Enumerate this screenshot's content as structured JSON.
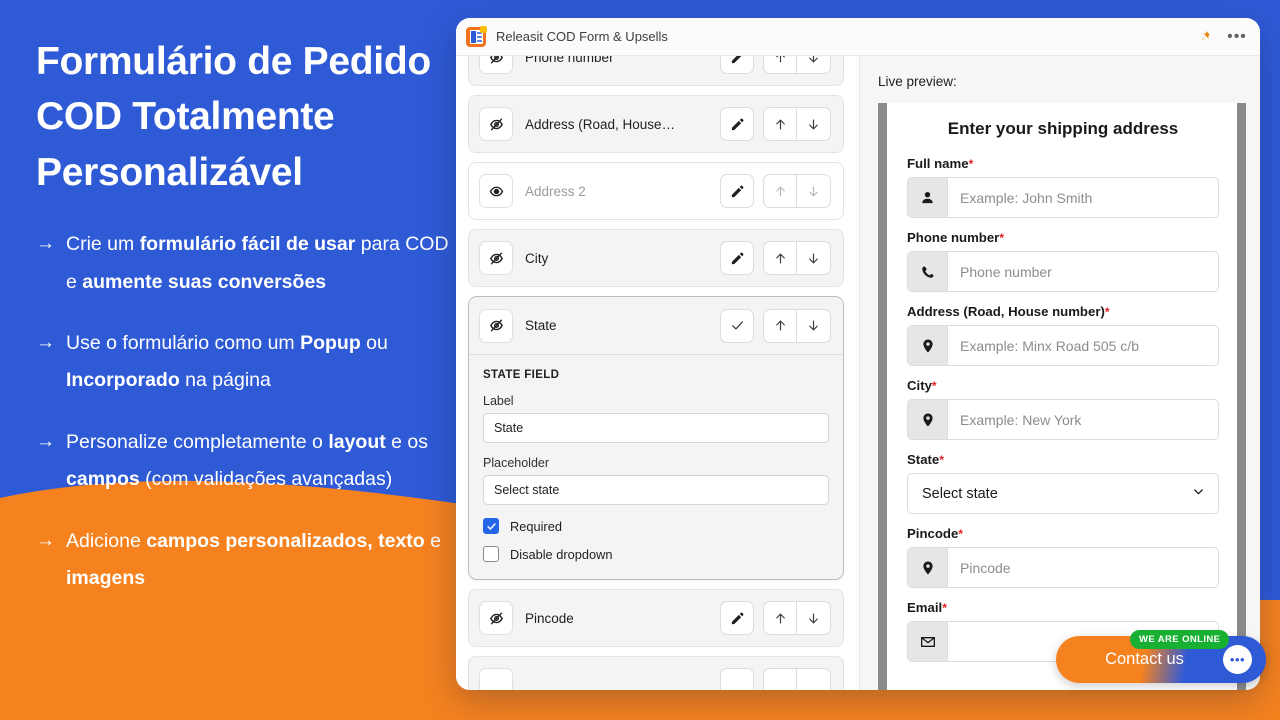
{
  "promo": {
    "title": "Formulário de Pedido COD Totalmente Personalizável",
    "arrow": "→",
    "bullets": [
      {
        "parts": [
          {
            "t": "Crie um ",
            "b": false
          },
          {
            "t": "formulário fácil de usar",
            "b": true
          },
          {
            "t": " para COD e ",
            "b": false
          },
          {
            "t": "aumente suas conversões",
            "b": true
          }
        ]
      },
      {
        "parts": [
          {
            "t": "Use o formulário como um ",
            "b": false
          },
          {
            "t": "Popup",
            "b": true
          },
          {
            "t": " ou ",
            "b": false
          },
          {
            "t": "Incorporado",
            "b": true
          },
          {
            "t": " na página",
            "b": false
          }
        ]
      },
      {
        "parts": [
          {
            "t": "Personalize completamente o ",
            "b": false
          },
          {
            "t": "layout",
            "b": true
          },
          {
            "t": " e os ",
            "b": false
          },
          {
            "t": "campos",
            "b": true
          },
          {
            "t": " (com validações avançadas)",
            "b": false
          }
        ]
      },
      {
        "parts": [
          {
            "t": "Adicione ",
            "b": false
          },
          {
            "t": "campos personalizados, texto",
            "b": true
          },
          {
            "t": " e ",
            "b": false
          },
          {
            "t": "imagens",
            "b": true
          }
        ]
      }
    ],
    "colors": {
      "blue": "#2f5ad6",
      "orange": "#f5821f",
      "white": "#ffffff"
    }
  },
  "window": {
    "title": "Releasit COD Form & Upsells",
    "app_icon": "releasit-app-icon",
    "pin_icon": "pushpin-icon",
    "more_icon": "more-options-icon",
    "more_label": "•••"
  },
  "field_list": {
    "rows": [
      {
        "label": "Phone number",
        "visibility_icon": "eye-off-icon",
        "hidden_style": false,
        "edit_icon": "pencil-icon",
        "up_icon": "arrow-up-icon",
        "down_icon": "arrow-down-icon",
        "faded": false
      },
      {
        "label": "Address (Road, House…",
        "visibility_icon": "eye-off-icon",
        "hidden_style": false,
        "edit_icon": "pencil-icon",
        "up_icon": "arrow-up-icon",
        "down_icon": "arrow-down-icon",
        "faded": false
      },
      {
        "label": "Address 2",
        "visibility_icon": "eye-icon",
        "hidden_style": true,
        "edit_icon": "pencil-icon",
        "up_icon": "arrow-up-icon",
        "down_icon": "arrow-down-icon",
        "faded": true
      },
      {
        "label": "City",
        "visibility_icon": "eye-off-icon",
        "hidden_style": false,
        "edit_icon": "pencil-icon",
        "up_icon": "arrow-up-icon",
        "down_icon": "arrow-down-icon",
        "faded": false
      }
    ],
    "expanded": {
      "label": "State",
      "visibility_icon": "eye-off-icon",
      "confirm_icon": "check-icon",
      "up_icon": "arrow-up-icon",
      "down_icon": "arrow-down-icon",
      "heading": "STATE FIELD",
      "label_field": {
        "label": "Label",
        "value": "State"
      },
      "placeholder_field": {
        "label": "Placeholder",
        "value": "Select state"
      },
      "checkboxes": [
        {
          "label": "Required",
          "checked": true
        },
        {
          "label": "Disable dropdown",
          "checked": false
        }
      ]
    },
    "rows_after": [
      {
        "label": "Pincode",
        "visibility_icon": "eye-off-icon",
        "hidden_style": false,
        "edit_icon": "pencil-icon",
        "up_icon": "arrow-up-icon",
        "down_icon": "arrow-down-icon",
        "faded": false
      }
    ]
  },
  "preview": {
    "title": "Live preview:",
    "heading": "Enter your shipping address",
    "required_mark": "*",
    "chevron_icon": "chevron-down-icon",
    "fields": [
      {
        "label": "Full name",
        "required": true,
        "icon": "person-icon",
        "placeholder": "Example: John Smith",
        "type": "input"
      },
      {
        "label": "Phone number",
        "required": true,
        "icon": "phone-icon",
        "placeholder": "Phone number",
        "type": "input"
      },
      {
        "label": "Address (Road, House number)",
        "required": true,
        "icon": "location-pin-icon",
        "placeholder": "Example: Minx Road 505 c/b",
        "type": "input"
      },
      {
        "label": "City",
        "required": true,
        "icon": "location-pin-icon",
        "placeholder": "Example: New York",
        "type": "input"
      },
      {
        "label": "State",
        "required": true,
        "icon": "",
        "placeholder": "Select state",
        "type": "select"
      },
      {
        "label": "Pincode",
        "required": true,
        "icon": "location-pin-icon",
        "placeholder": "Pincode",
        "type": "input"
      },
      {
        "label": "Email",
        "required": true,
        "icon": "mail-icon",
        "placeholder": "",
        "type": "input"
      }
    ]
  },
  "contact_widget": {
    "label": "Contact us",
    "badge": "WE ARE ONLINE",
    "bubble_icon": "chat-bubble-icon",
    "bubble_dots": "•••",
    "colors": {
      "orange": "#f5821f",
      "blue": "#2f5ad6",
      "green": "#18b033"
    }
  }
}
